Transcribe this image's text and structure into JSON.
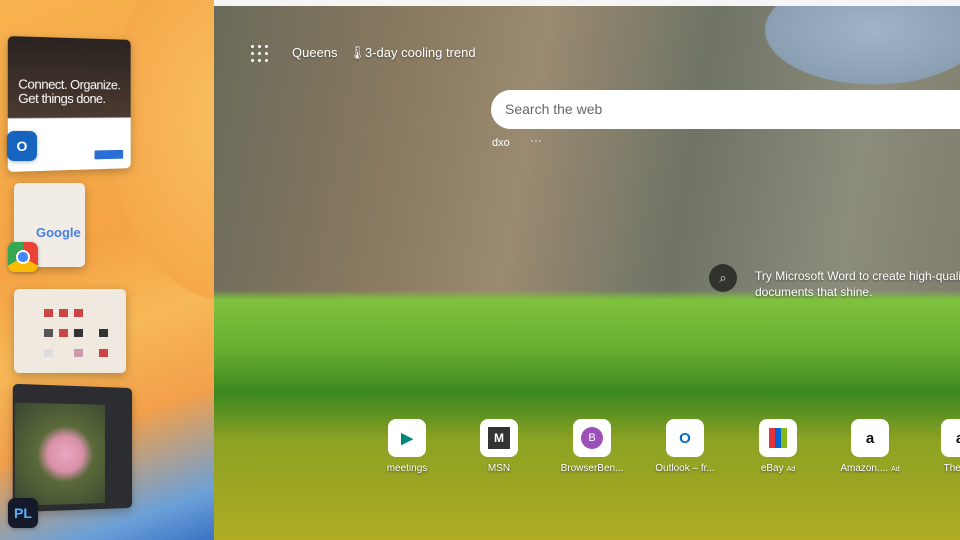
{
  "stage_manager": {
    "outlook_preview": {
      "headline": "Connect. Organize. Get things done.",
      "icon": "outlook-icon"
    },
    "chrome_preview": {
      "logo_text": "Google",
      "icon": "chrome-icon"
    },
    "finder_preview": {
      "icon": "finder-window"
    },
    "photolab_preview": {
      "app_badge": "PL",
      "icon": "dxo-photolab-icon"
    }
  },
  "header": {
    "location": "Queens",
    "weather": "3-day cooling trend"
  },
  "search": {
    "placeholder": "Search the web"
  },
  "quick_links": {
    "dxo": "dxo",
    "more": "···"
  },
  "tip": {
    "text": "Try Microsoft Word to create high-quality documents that shine."
  },
  "tiles": [
    {
      "label": "meetings",
      "ad": ""
    },
    {
      "label": "MSN",
      "ad": ""
    },
    {
      "label": "BrowserBen...",
      "ad": ""
    },
    {
      "label": "Outlook – fr...",
      "ad": ""
    },
    {
      "label": "eBay",
      "ad": "Ad"
    },
    {
      "label": "Amazon....",
      "ad": "Ad"
    },
    {
      "label": "The Ne",
      "ad": ""
    }
  ]
}
